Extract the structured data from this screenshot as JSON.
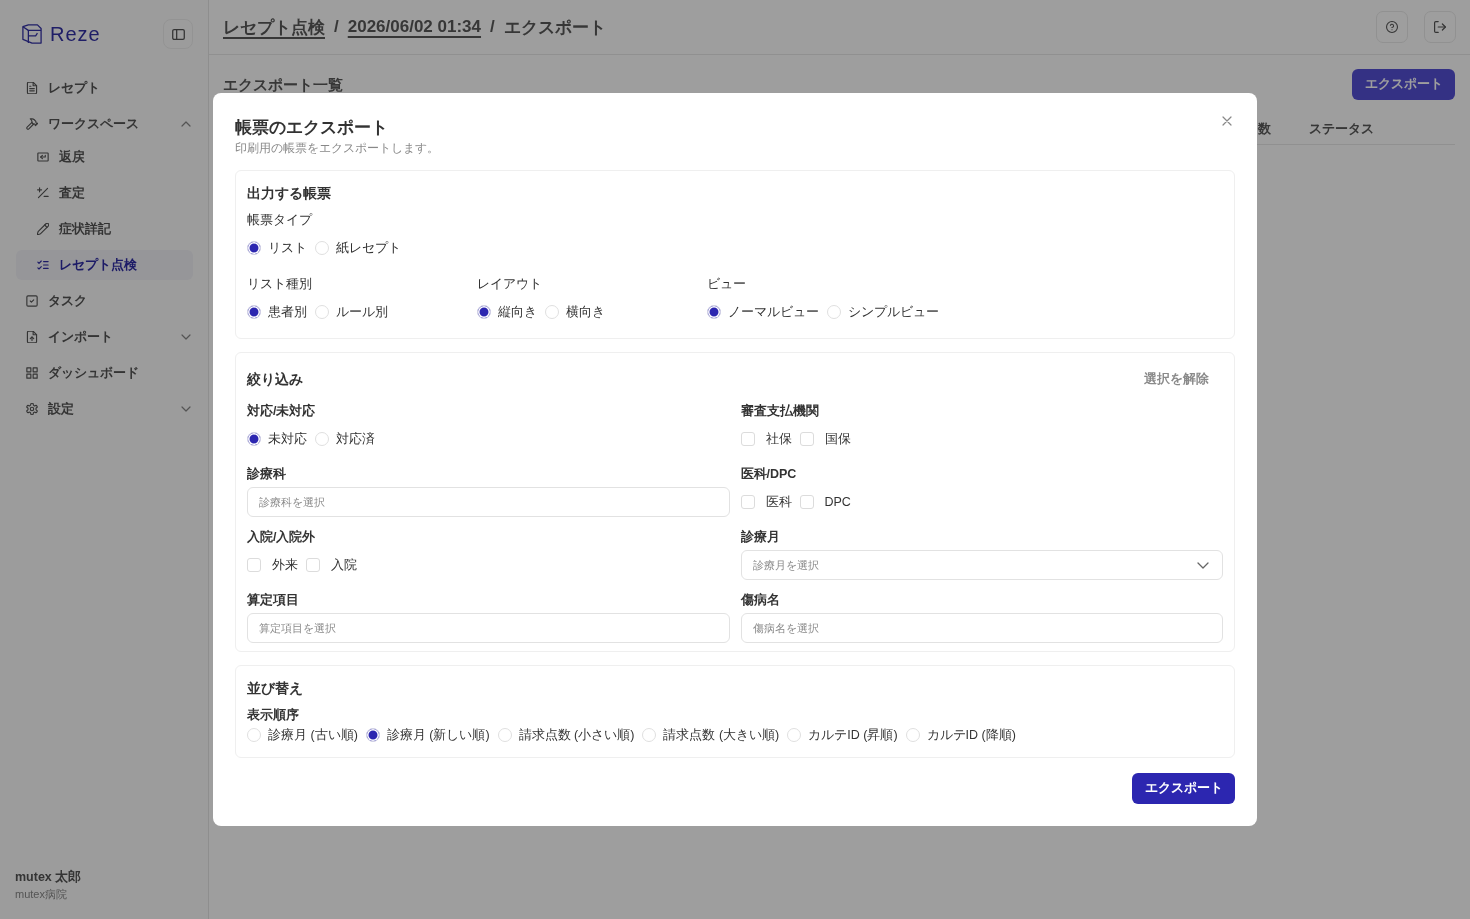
{
  "sidebar": {
    "logo": "Reze",
    "items": [
      {
        "label": "レセプト",
        "kind": "link",
        "selected": false
      },
      {
        "label": "ワークスペース",
        "kind": "group",
        "expanded": true,
        "selected": false,
        "children": [
          {
            "label": "返戻",
            "selected": false
          },
          {
            "label": "査定",
            "selected": false
          },
          {
            "label": "症状詳記",
            "selected": false
          },
          {
            "label": "レセプト点検",
            "selected": true
          }
        ]
      },
      {
        "label": "タスク",
        "kind": "link",
        "selected": false
      },
      {
        "label": "インポート",
        "kind": "group",
        "expanded": false,
        "selected": false
      },
      {
        "label": "ダッシュボード",
        "kind": "link",
        "selected": false
      },
      {
        "label": "設定",
        "kind": "group",
        "expanded": false,
        "selected": false
      }
    ],
    "user": {
      "name": "mutex 太郎",
      "organization": "mutex病院"
    }
  },
  "header": {
    "breadcrumb": [
      {
        "kind": "link",
        "label": "レセプト点検"
      },
      {
        "kind": "separator",
        "label": "/"
      },
      {
        "kind": "link",
        "label": "2026/06/02 01:34"
      },
      {
        "kind": "separator",
        "label": "/"
      },
      {
        "kind": "current",
        "label": "エクスポート"
      }
    ]
  },
  "page": {
    "title": "エクスポート一覧",
    "export_button": "エクスポート",
    "table": {
      "columns": [
        "数",
        "ステータス"
      ]
    }
  },
  "modal": {
    "title": "帳票のエクスポート",
    "description": "印刷用の帳票をエクスポートします。",
    "sections": [
      {
        "title": "出力する帳票",
        "rows": [
          [
            {
              "label": "帳票タイプ",
              "kind": "radio",
              "options": [
                {
                  "label": "リスト",
                  "selected": true
                },
                {
                  "label": "紙レセプト",
                  "selected": false
                }
              ]
            }
          ],
          [
            {
              "label": "リスト種別",
              "kind": "radio",
              "options": [
                {
                  "label": "患者別",
                  "selected": true
                },
                {
                  "label": "ルール別",
                  "selected": false
                }
              ]
            },
            {
              "label": "レイアウト",
              "kind": "radio",
              "options": [
                {
                  "label": "縦向き",
                  "selected": true
                },
                {
                  "label": "横向き",
                  "selected": false
                }
              ]
            },
            {
              "label": "ビュー",
              "kind": "radio",
              "options": [
                {
                  "label": "ノーマルビュー",
                  "selected": true
                },
                {
                  "label": "シンプルビュー",
                  "selected": false
                }
              ]
            }
          ]
        ]
      },
      {
        "title": "絞り込み",
        "action": "選択を解除",
        "rows": [
          [
            {
              "label": "対応/未対応",
              "kind": "radio",
              "options": [
                {
                  "label": "未対応",
                  "selected": true
                },
                {
                  "label": "対応済",
                  "selected": false
                }
              ]
            },
            {
              "label": "審査支払機関",
              "kind": "checkbox",
              "options": [
                {
                  "label": "社保",
                  "checked": false
                },
                {
                  "label": "国保",
                  "checked": false
                }
              ]
            }
          ],
          [
            {
              "label": "診療科",
              "kind": "input",
              "placeholder": "診療科を選択"
            },
            {
              "label": "医科/DPC",
              "kind": "checkbox",
              "options": [
                {
                  "label": "医科",
                  "checked": false
                },
                {
                  "label": "DPC",
                  "checked": false
                }
              ]
            }
          ],
          [
            {
              "label": "入院/入院外",
              "kind": "checkbox",
              "options": [
                {
                  "label": "外来",
                  "checked": false
                },
                {
                  "label": "入院",
                  "checked": false
                }
              ]
            },
            {
              "label": "診療月",
              "kind": "select",
              "placeholder": "診療月を選択"
            }
          ],
          [
            {
              "label": "算定項目",
              "kind": "input",
              "placeholder": "算定項目を選択"
            },
            {
              "label": "傷病名",
              "kind": "input",
              "placeholder": "傷病名を選択"
            }
          ]
        ]
      },
      {
        "title": "並び替え",
        "rows": [
          [
            {
              "label": "表示順序",
              "kind": "radio",
              "options": [
                {
                  "label": "診療月 (古い順)",
                  "selected": false
                },
                {
                  "label": "診療月 (新しい順)",
                  "selected": true
                },
                {
                  "label": "請求点数 (小さい順)",
                  "selected": false
                },
                {
                  "label": "請求点数 (大きい順)",
                  "selected": false
                },
                {
                  "label": "カルテID (昇順)",
                  "selected": false
                },
                {
                  "label": "カルテID (降順)",
                  "selected": false
                }
              ]
            }
          ]
        ]
      }
    ],
    "submit": "エクスポート"
  }
}
